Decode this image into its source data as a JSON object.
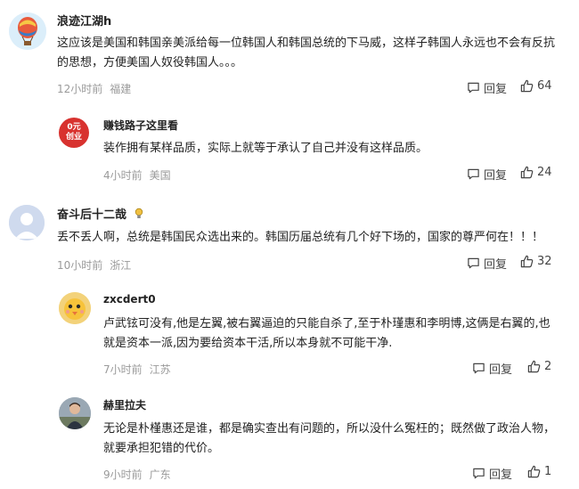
{
  "comments": [
    {
      "username": "浪迹江湖h",
      "text": "这应该是美国和韩国亲美派给每一位韩国人和韩国总统的下马威，这样子韩国人永远也不会有反抗的思想，方便美国人奴役韩国人。。。",
      "time": "12小时前",
      "location": "福建",
      "reply_label": "回复",
      "likes": "64",
      "avatar_icon": "hot-air-balloon-icon"
    },
    {
      "username": "赚钱路子这里看",
      "text": "装作拥有某样品质，实际上就等于承认了自己并没有这样品质。",
      "time": "4小时前",
      "location": "美国",
      "reply_label": "回复",
      "likes": "24",
      "avatar_line1": "0元",
      "avatar_line2": "创业"
    },
    {
      "username": "奋斗后十二哉",
      "text": "丢不丢人啊，总统是韩国民众选出来的。韩国历届总统有几个好下场的，国家的尊严何在！！！",
      "time": "10小时前",
      "location": "浙江",
      "reply_label": "回复",
      "likes": "32",
      "avatar_icon": "default-user-icon",
      "badge_icon": "lightbulb-icon"
    },
    {
      "username": "zxcdert0",
      "text": "卢武铉可没有,他是左翼,被右翼逼迫的只能自杀了,至于朴瑾惠和李明博,这俩是右翼的,也就是资本一派,因为要给资本干活,所以本身就不可能干净.",
      "time": "7小时前",
      "location": "江苏",
      "reply_label": "回复",
      "likes": "2",
      "avatar_icon": "chick-cartoon-icon"
    },
    {
      "username": "赫里拉夫",
      "text": "无论是朴槿惠还是谁，都是确实查出有问题的，所以没什么冤枉的；既然做了政治人物，就要承担犯错的代价。",
      "time": "9小时前",
      "location": "广东",
      "reply_label": "回复",
      "likes": "1",
      "avatar_icon": "person-photo-icon"
    }
  ]
}
